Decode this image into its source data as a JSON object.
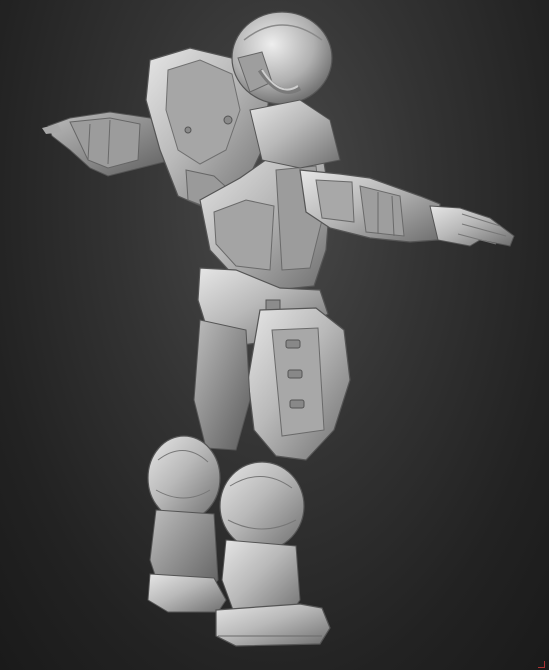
{
  "scene": {
    "background_color": "#2a2a2a",
    "material_color": "#b8b8b8",
    "shadow_color": "#6a6a6a",
    "highlight_color": "#e2e2e2",
    "subject": "armored-figure-sculpt"
  }
}
